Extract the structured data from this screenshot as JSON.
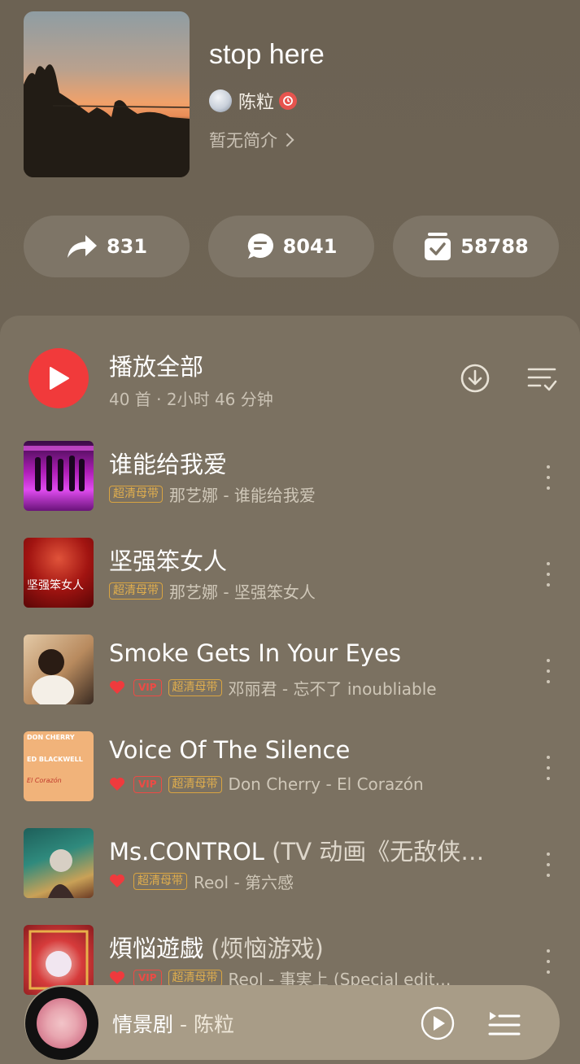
{
  "playlist": {
    "title": "stop here",
    "creator": "陈粒",
    "intro": "暂无简介"
  },
  "stats": {
    "share_count": "831",
    "comment_count": "8041",
    "collect_count": "58788"
  },
  "list_header": {
    "play_all_label": "播放全部",
    "meta": "40 首 · 2小时 46 分钟"
  },
  "songs": [
    {
      "title": "谁能给我爱",
      "subtitle": "",
      "quality": "超清母带",
      "vip": "",
      "liked": false,
      "artist_album": "那艺娜 - 谁能给我爱"
    },
    {
      "title": "坚强笨女人",
      "subtitle": "",
      "quality": "超清母带",
      "vip": "",
      "liked": false,
      "artist_album": "那艺娜 - 坚强笨女人"
    },
    {
      "title": "Smoke Gets In Your Eyes",
      "subtitle": "",
      "quality": "超清母带",
      "vip": "VIP",
      "liked": true,
      "artist_album": "邓丽君 - 忘不了 inoubliable"
    },
    {
      "title": "Voice Of The Silence",
      "subtitle": "",
      "quality": "超清母带",
      "vip": "VIP",
      "liked": true,
      "artist_album": "Don Cherry - El Corazón"
    },
    {
      "title": "Ms.CONTROL",
      "subtitle": " (TV 动画《无敌侠…",
      "quality": "超清母带",
      "vip": "",
      "liked": true,
      "artist_album": "Reol - 第六感"
    },
    {
      "title": "煩悩遊戯",
      "subtitle": " (烦恼游戏)",
      "quality": "超清母带",
      "vip": "VIP",
      "liked": true,
      "artist_album": "Reol - 事実上 (Special edit…"
    }
  ],
  "thumb_text": {
    "song2": "坚强笨女人",
    "song4_line1": "DON CHERRY",
    "song4_line2": "ED BLACKWELL",
    "song4_line3": "El Corazón"
  },
  "now_playing": {
    "title": "情景剧",
    "separator": " - ",
    "artist": "陈粒"
  },
  "colors": {
    "accent_red": "#f13a3b",
    "quality_tag": "#d9a441",
    "background": "#7b7161"
  }
}
